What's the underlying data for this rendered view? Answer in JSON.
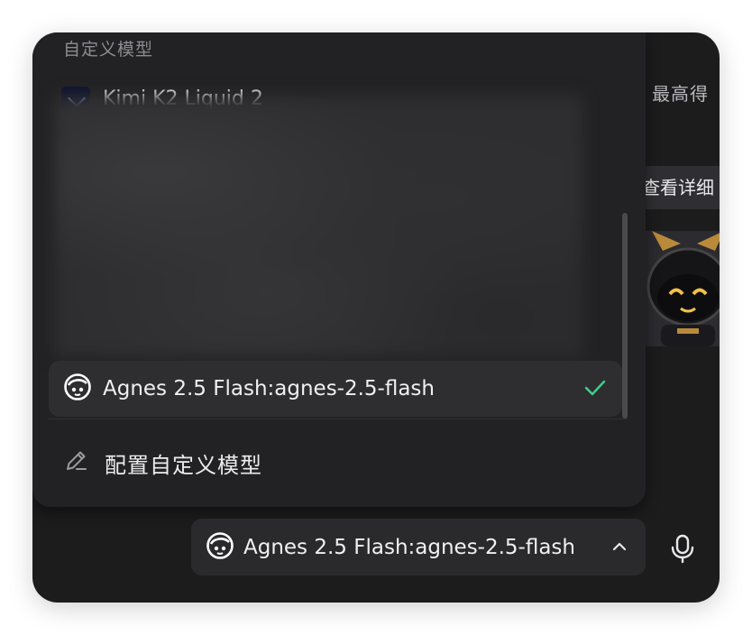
{
  "background": {
    "heading_fragment": "最高得",
    "details_button": "查看详细"
  },
  "dropdown": {
    "section_title": "自定义模型",
    "partially_hidden_item": "Kimi K2 Liquid 2",
    "selected_model": {
      "label": "Agnes 2.5 Flash:agnes-2.5-flash",
      "icon": "agnes-logo-icon",
      "state": "selected"
    },
    "configure_label": "配置自定义模型",
    "configure_icon": "pencil-icon"
  },
  "composer": {
    "model_selector_label": "Agnes 2.5 Flash:agnes-2.5-flash",
    "chevron": "chevron-up-icon",
    "mic": "microphone-icon"
  },
  "colors": {
    "check": "#3ecf8e",
    "window_bg": "#1c1c1d",
    "panel_bg": "#222224"
  }
}
